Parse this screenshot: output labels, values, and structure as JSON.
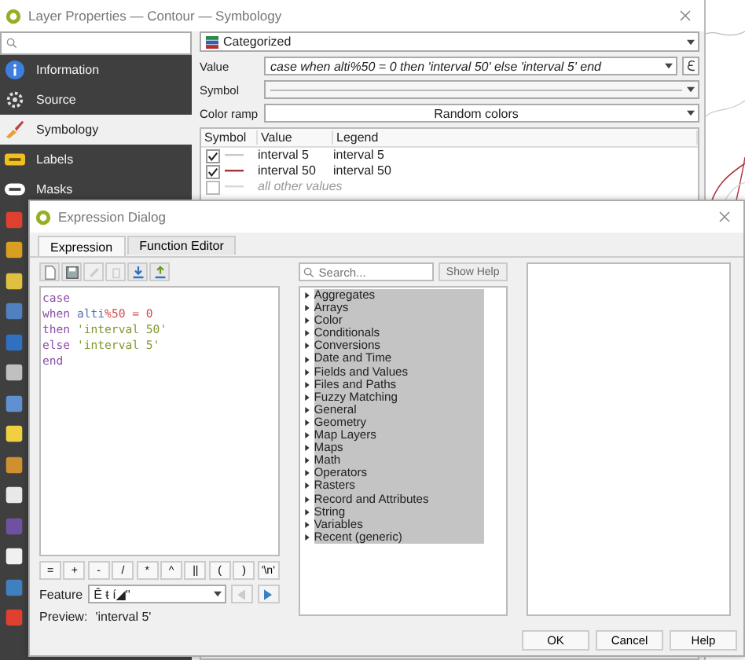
{
  "layer_properties": {
    "title": "Layer Properties — Contour — Symbology",
    "sidebar": [
      {
        "label": "Information",
        "selected": false
      },
      {
        "label": "Source",
        "selected": false
      },
      {
        "label": "Symbology",
        "selected": true
      },
      {
        "label": "Labels",
        "selected": false
      },
      {
        "label": "Masks",
        "selected": false
      }
    ],
    "renderer": "Categorized",
    "value_label": "Value",
    "value": "case  when alti%50 = 0  then 'interval 50' else 'interval 5' end",
    "symbol_label": "Symbol",
    "color_ramp_label": "Color ramp",
    "color_ramp": "Random colors",
    "table": {
      "columns": [
        "Symbol",
        "Value",
        "Legend"
      ],
      "rows": [
        {
          "kind": "category",
          "checked": true,
          "color": "#c8c8c8",
          "value": "interval 5",
          "legend": "interval 5"
        },
        {
          "kind": "category",
          "checked": true,
          "color": "#a8323c",
          "value": "interval 50",
          "legend": "interval 50"
        },
        {
          "kind": "other",
          "checked": false,
          "color": "#d8d8d8",
          "value": "all other values"
        }
      ]
    }
  },
  "expression_dialog": {
    "title": "Expression Dialog",
    "tabs": [
      {
        "label": "Expression",
        "selected": true
      },
      {
        "label": "Function Editor",
        "selected": false
      }
    ],
    "editor_lines": [
      [
        {
          "text": "case",
          "kind": "keyword"
        }
      ],
      [
        {
          "text": "when",
          "kind": "keyword"
        },
        {
          "text": " alti",
          "kind": "field"
        },
        {
          "text": "%50 = 0",
          "kind": "number"
        }
      ],
      [
        {
          "text": "then",
          "kind": "keyword"
        },
        {
          "text": " 'interval 50'",
          "kind": "string"
        }
      ],
      [
        {
          "text": "else",
          "kind": "keyword"
        },
        {
          "text": " 'interval 5'",
          "kind": "string"
        }
      ],
      [
        {
          "text": "end",
          "kind": "keyword"
        }
      ]
    ],
    "operators": [
      "=",
      "+",
      "-",
      "/",
      "*",
      "^",
      "||",
      "(",
      ")",
      "'\\n'"
    ],
    "feature_label": "Feature",
    "feature_value": "Ê ŧ í◢\"",
    "preview_label": "Preview:",
    "preview_value": "'interval 5'",
    "search": {
      "placeholder": "Search..."
    },
    "show_help": "Show Help",
    "groups": [
      "Aggregates",
      "Arrays",
      "Color",
      "Conditionals",
      "Conversions",
      "Date and Time",
      "Fields and Values",
      "Files and Paths",
      "Fuzzy Matching",
      "General",
      "Geometry",
      "Map Layers",
      "Maps",
      "Math",
      "Operators",
      "Rasters",
      "Record and Attributes",
      "String",
      "Variables",
      "Recent (generic)"
    ],
    "buttons": [
      "OK",
      "Cancel",
      "Help"
    ]
  }
}
